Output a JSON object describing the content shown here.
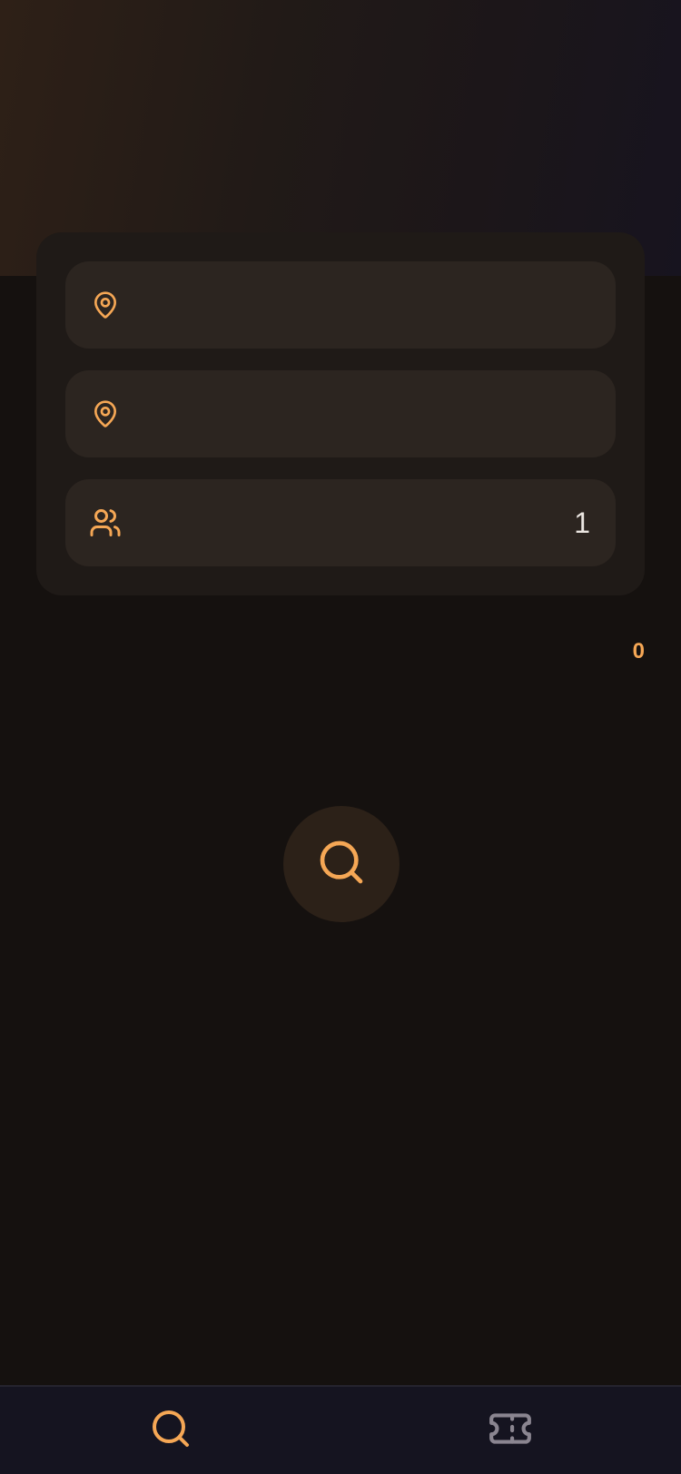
{
  "colors": {
    "accent": "#f5a755",
    "background": "#15110f",
    "card": "#1f1a17",
    "field": "#2c2520",
    "nav_background": "#151420",
    "inactive_icon": "#8a8590"
  },
  "form": {
    "origin": {
      "icon": "map-pin-icon",
      "value": ""
    },
    "destination": {
      "icon": "map-pin-icon",
      "value": ""
    },
    "passengers": {
      "icon": "users-icon",
      "count": "1"
    }
  },
  "results": {
    "count": "0"
  },
  "search_button": {
    "icon": "search-icon"
  },
  "bottom_nav": {
    "items": [
      {
        "icon": "search-icon",
        "active": true
      },
      {
        "icon": "ticket-icon",
        "active": false
      }
    ]
  }
}
